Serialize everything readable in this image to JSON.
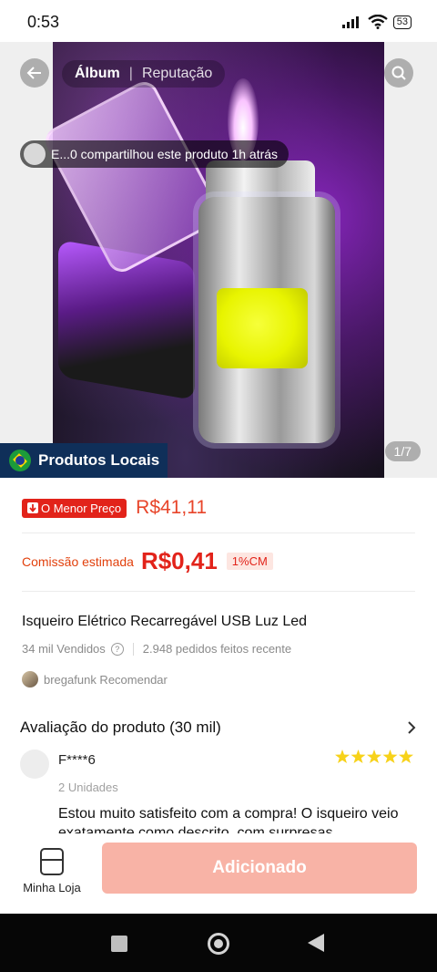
{
  "status": {
    "time": "0:53",
    "battery": "53"
  },
  "gallery": {
    "tabs": [
      "Álbum",
      "Reputação"
    ],
    "share_text": "E...0 compartilhou este produto 1h atrás",
    "local_badge": "Produtos Locais",
    "page_indicator": "1/7"
  },
  "pricing": {
    "lowest_badge": "O Menor Preço",
    "price": "R$41,11",
    "commission_label": "Comissão estimada",
    "commission_value": "R$0,41",
    "commission_badge": "1%CM"
  },
  "product": {
    "title": "Isqueiro Elétrico Recarregável USB Luz Led",
    "sold": "34 mil Vendidos",
    "orders": "2.948 pedidos feitos recente",
    "recommender": "bregafunk Recomendar"
  },
  "reviews": {
    "title": "Avaliação do produto (30 mil)",
    "item": {
      "user": "F****6",
      "rating": 5,
      "variant": "2 Unidades",
      "text": "Estou muito satisfeito com a compra! O isqueiro veio exatamente como descrito, com surpresas"
    }
  },
  "bottom": {
    "store_label": "Minha Loja",
    "add_button": "Adicionado"
  },
  "colors": {
    "accent": "#e2231a",
    "price": "#e8452a",
    "badge_bg": "#0f2f59",
    "add_button_bg": "#f8b3a6"
  },
  "icons": [
    "back-arrow-icon",
    "search-icon",
    "info-icon",
    "chevron-right-icon",
    "store-icon",
    "star-icon",
    "down-arrow-icon"
  ]
}
